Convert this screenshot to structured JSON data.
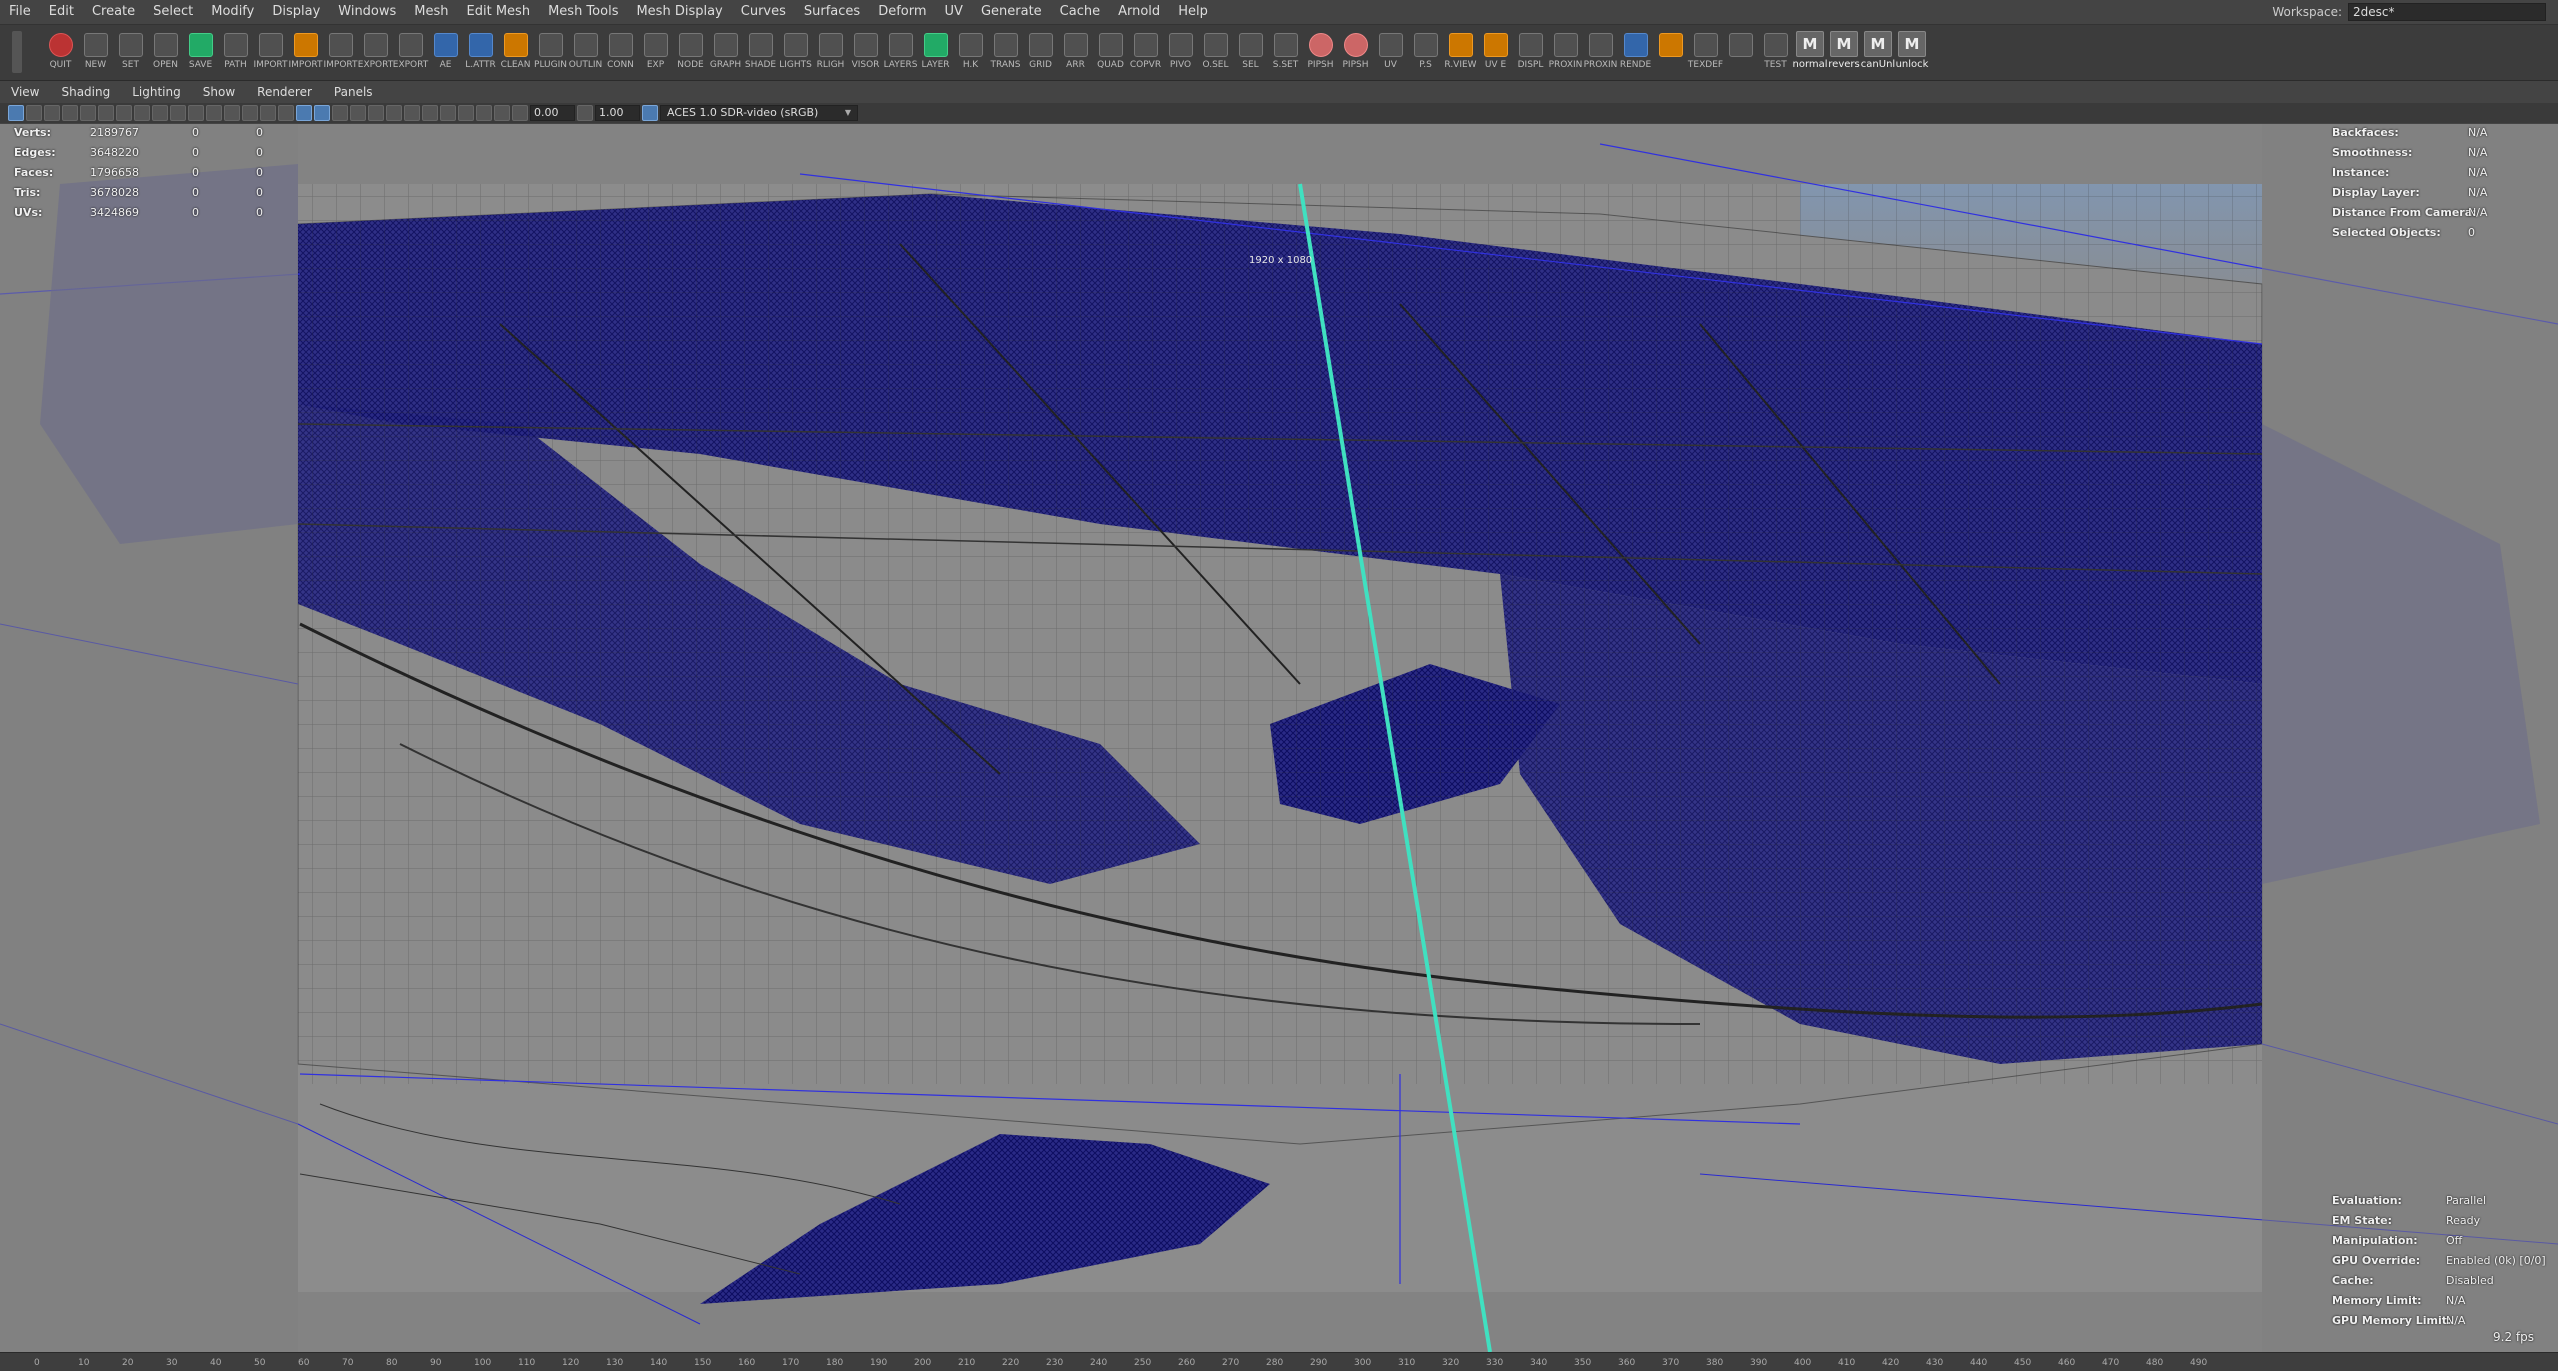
{
  "menubar": {
    "items": [
      "File",
      "Edit",
      "Create",
      "Select",
      "Modify",
      "Display",
      "Windows",
      "Mesh",
      "Edit Mesh",
      "Mesh Tools",
      "Mesh Display",
      "Curves",
      "Surfaces",
      "Deform",
      "UV",
      "Generate",
      "Cache",
      "Arnold",
      "Help"
    ],
    "workspace_label": "Workspace:",
    "workspace_value": "2desc*"
  },
  "shelf": {
    "tools": [
      {
        "label": "QUIT",
        "icon": "quit-icon",
        "color": "red"
      },
      {
        "label": "NEW",
        "icon": "new-file-icon",
        "color": ""
      },
      {
        "label": "SET",
        "icon": "set-project-icon",
        "color": ""
      },
      {
        "label": "OPEN",
        "icon": "open-icon",
        "color": ""
      },
      {
        "label": "SAVE",
        "icon": "save-icon",
        "color": "green"
      },
      {
        "label": "PATH",
        "icon": "path-icon",
        "color": ""
      },
      {
        "label": "IMPORT",
        "icon": "import-icon",
        "color": ""
      },
      {
        "label": "IMPORT",
        "icon": "import-icon",
        "color": "orange"
      },
      {
        "label": "IMPORT",
        "icon": "import-icon",
        "color": ""
      },
      {
        "label": "EXPORT",
        "icon": "export-icon",
        "color": ""
      },
      {
        "label": "EXPORT",
        "icon": "export-icon",
        "color": ""
      },
      {
        "label": "AE",
        "icon": "after-effects-icon",
        "color": "blue"
      },
      {
        "label": "L.ATTR",
        "icon": "attr-icon",
        "color": "blue"
      },
      {
        "label": "CLEAN",
        "icon": "clean-icon",
        "color": "orange"
      },
      {
        "label": "PLUGIN",
        "icon": "plugin-icon",
        "color": ""
      },
      {
        "label": "OUTLIN",
        "icon": "outliner-icon",
        "color": ""
      },
      {
        "label": "CONN",
        "icon": "connect-icon",
        "color": ""
      },
      {
        "label": "EXP",
        "icon": "expression-icon",
        "color": ""
      },
      {
        "label": "NODE",
        "icon": "node-icon",
        "color": ""
      },
      {
        "label": "GRAPH",
        "icon": "graph-icon",
        "color": ""
      },
      {
        "label": "SHADE",
        "icon": "shade-icon",
        "color": ""
      },
      {
        "label": "LIGHTS",
        "icon": "lights-icon",
        "color": ""
      },
      {
        "label": "RLIGH",
        "icon": "render-light-icon",
        "color": ""
      },
      {
        "label": "VISOR",
        "icon": "visor-icon",
        "color": ""
      },
      {
        "label": "LAYERS",
        "icon": "layers-icon",
        "color": ""
      },
      {
        "label": "LAYER",
        "icon": "layer-icon",
        "color": "green"
      },
      {
        "label": "H.K",
        "icon": "hotkey-icon",
        "color": ""
      },
      {
        "label": "TRANS",
        "icon": "transform-icon",
        "color": ""
      },
      {
        "label": "GRID",
        "icon": "grid-icon",
        "color": ""
      },
      {
        "label": "ARR",
        "icon": "arrow-icon",
        "color": ""
      },
      {
        "label": "QUAD",
        "icon": "quad-icon",
        "color": ""
      },
      {
        "label": "COPVR",
        "icon": "copy-icon",
        "color": ""
      },
      {
        "label": "PIVO",
        "icon": "pivot-icon",
        "color": ""
      },
      {
        "label": "O.SEL",
        "icon": "object-select-icon",
        "color": ""
      },
      {
        "label": "SEL",
        "icon": "select-icon",
        "color": ""
      },
      {
        "label": "S.SET",
        "icon": "selection-set-icon",
        "color": ""
      },
      {
        "label": "PIPSH",
        "icon": "pipsh-icon",
        "color": "pink"
      },
      {
        "label": "PIPSH",
        "icon": "pipsh-icon",
        "color": "pink"
      },
      {
        "label": "UV",
        "icon": "uv-icon",
        "color": ""
      },
      {
        "label": "P.S",
        "icon": "ps-icon",
        "color": ""
      },
      {
        "label": "R.VIEW",
        "icon": "render-view-icon",
        "color": "orange"
      },
      {
        "label": "UV E",
        "icon": "uv-editor-icon",
        "color": "orange"
      },
      {
        "label": "DISPL",
        "icon": "display-icon",
        "color": ""
      },
      {
        "label": "PROXIN",
        "icon": "proxy-icon",
        "color": ""
      },
      {
        "label": "PROXIN",
        "icon": "proxy-icon",
        "color": ""
      },
      {
        "label": "RENDE",
        "icon": "render-icon",
        "color": "blue"
      },
      {
        "label": "",
        "icon": "camera-icon",
        "color": "orange"
      },
      {
        "label": "TEXDEF",
        "icon": "texture-icon",
        "color": ""
      },
      {
        "label": "",
        "icon": "playblast-icon",
        "color": ""
      },
      {
        "label": "TEST",
        "icon": "test-icon",
        "color": ""
      }
    ],
    "mel_buttons": [
      {
        "label": "normal",
        "icon": "m-icon"
      },
      {
        "label": "revers",
        "icon": "m-icon"
      },
      {
        "label": "canUnl",
        "icon": "m-icon"
      },
      {
        "label": "unlock",
        "icon": "m-icon"
      }
    ],
    "mel_glyph": "M"
  },
  "panel_menu": [
    "View",
    "Shading",
    "Lighting",
    "Show",
    "Renderer",
    "Panels"
  ],
  "panel_toolbar": {
    "exposure": "0.00",
    "gamma": "1.00",
    "color_space": "ACES 1.0 SDR-video (sRGB)"
  },
  "viewport": {
    "resolution_gate": "1920 x 1080",
    "poly_count": [
      {
        "label": "Verts:",
        "a": "2189767",
        "b": "0",
        "c": "0"
      },
      {
        "label": "Edges:",
        "a": "3648220",
        "b": "0",
        "c": "0"
      },
      {
        "label": "Faces:",
        "a": "1796658",
        "b": "0",
        "c": "0"
      },
      {
        "label": "Tris:",
        "a": "3678028",
        "b": "0",
        "c": "0"
      },
      {
        "label": "UVs:",
        "a": "3424869",
        "b": "0",
        "c": "0"
      }
    ],
    "object_details": [
      {
        "label": "Backfaces:",
        "value": "N/A"
      },
      {
        "label": "Smoothness:",
        "value": "N/A"
      },
      {
        "label": "Instance:",
        "value": "N/A"
      },
      {
        "label": "Display Layer:",
        "value": "N/A"
      },
      {
        "label": "Distance From Camera:",
        "value": "N/A"
      },
      {
        "label": "Selected Objects:",
        "value": "0"
      }
    ],
    "evaluation": [
      {
        "label": "Evaluation:",
        "value": "Parallel"
      },
      {
        "label": "EM State:",
        "value": "Ready"
      },
      {
        "label": "Manipulation:",
        "value": "Off"
      },
      {
        "label": "GPU Override:",
        "value": "Enabled (0k) [0/0]"
      },
      {
        "label": "Cache:",
        "value": "Disabled"
      },
      {
        "label": "Memory Limit:",
        "value": "N/A"
      },
      {
        "label": "GPU Memory Limit:",
        "value": "N/A"
      }
    ],
    "fps": "9.2 fps"
  },
  "timeline": {
    "ticks": [
      "0",
      "10",
      "20",
      "30",
      "40",
      "50",
      "60",
      "70",
      "80",
      "90",
      "100",
      "110",
      "120",
      "130",
      "140",
      "150",
      "160",
      "170",
      "180",
      "190",
      "200",
      "210",
      "220",
      "230",
      "240",
      "250",
      "260",
      "270",
      "280",
      "290",
      "300",
      "310",
      "320",
      "330",
      "340",
      "350",
      "360",
      "370",
      "380",
      "390",
      "400",
      "410",
      "420",
      "430",
      "440",
      "450",
      "460",
      "470",
      "480",
      "490"
    ]
  },
  "colors": {
    "viewport_bg": "#838383",
    "wireframe": "#1a1a80",
    "camera_line": "#40e0c0"
  }
}
